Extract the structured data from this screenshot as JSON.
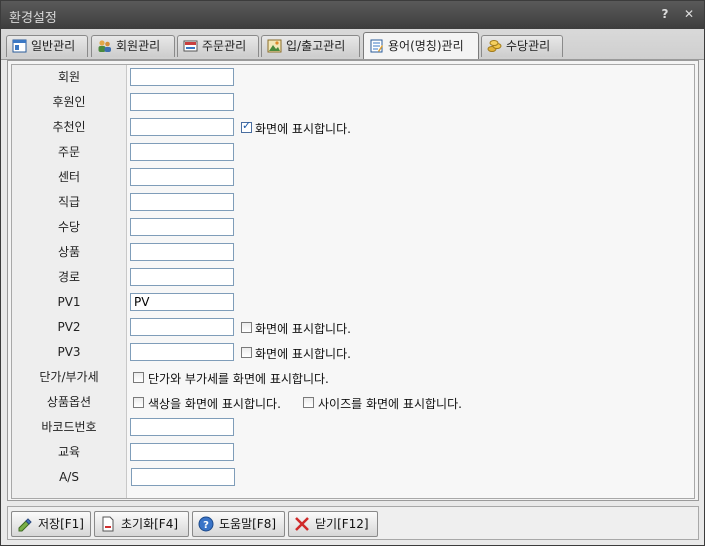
{
  "window": {
    "title": "환경설정",
    "help_label": "?",
    "close_label": "✕"
  },
  "tabs": [
    {
      "label": "일반관리",
      "icon": "window-icon"
    },
    {
      "label": "회원관리",
      "icon": "users-icon"
    },
    {
      "label": "주문관리",
      "icon": "order-icon"
    },
    {
      "label": "입/출고관리",
      "icon": "picture-icon"
    },
    {
      "label": "용어(명칭)관리",
      "icon": "notebook-icon",
      "active": true
    },
    {
      "label": "수당관리",
      "icon": "coins-icon"
    }
  ],
  "rows": [
    {
      "label": "회원",
      "value": ""
    },
    {
      "label": "후원인",
      "value": ""
    },
    {
      "label": "추천인",
      "value": "",
      "checkbox": {
        "label": "화면에 표시합니다.",
        "checked": true
      }
    },
    {
      "label": "주문",
      "value": ""
    },
    {
      "label": "센터",
      "value": ""
    },
    {
      "label": "직급",
      "value": ""
    },
    {
      "label": "수당",
      "value": ""
    },
    {
      "label": "상품",
      "value": ""
    },
    {
      "label": "경로",
      "value": ""
    },
    {
      "label": "PV1",
      "value": "PV"
    },
    {
      "label": "PV2",
      "value": "",
      "checkbox": {
        "label": "화면에 표시합니다.",
        "checked": false
      }
    },
    {
      "label": "PV3",
      "value": "",
      "checkbox": {
        "label": "화면에 표시합니다.",
        "checked": false
      }
    },
    {
      "label": "단가/부가세",
      "checks": [
        {
          "label": "단가와 부가세를 화면에 표시합니다.",
          "checked": false
        }
      ]
    },
    {
      "label": "상품옵션",
      "checks": [
        {
          "label": "색상을 화면에 표시합니다.",
          "checked": false
        },
        {
          "label": "사이즈를 화면에 표시합니다.",
          "checked": false
        }
      ]
    },
    {
      "label": "바코드번호",
      "value": ""
    },
    {
      "label": "교육",
      "value": ""
    },
    {
      "label": "A/S",
      "value": ""
    }
  ],
  "buttons": {
    "save": {
      "label": "저장[F1]",
      "icon": "save-icon"
    },
    "reset": {
      "label": "초기화[F4]",
      "icon": "document-icon"
    },
    "help": {
      "label": "도움말[F8]",
      "icon": "help-icon"
    },
    "close": {
      "label": "닫기[F12]",
      "icon": "close-x-icon"
    }
  }
}
